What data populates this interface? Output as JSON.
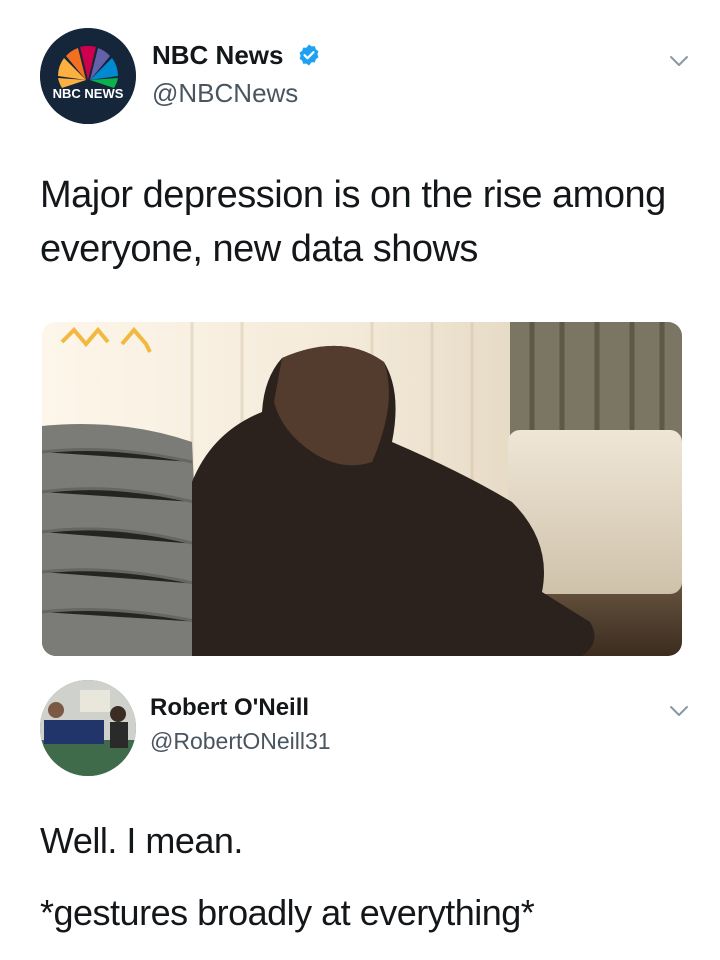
{
  "tweet": {
    "display_name": "NBC News",
    "handle": "@NBCNews",
    "verified": true,
    "avatar_logo_text": "NBC NEWS",
    "text": "Major depression is on the rise among everyone, new data shows",
    "media_icon": "photo-of-sad-woman-sitting-on-floor"
  },
  "reply": {
    "display_name": "Robert O'Neill",
    "handle": "@RobertONeill31",
    "line1": "Well. I mean.",
    "line2": "*gestures broadly at everything*"
  },
  "colors": {
    "text": "#14171a",
    "secondary_text": "#4a5560",
    "verified_blue": "#1da1f2",
    "chevron": "#8899a6"
  }
}
